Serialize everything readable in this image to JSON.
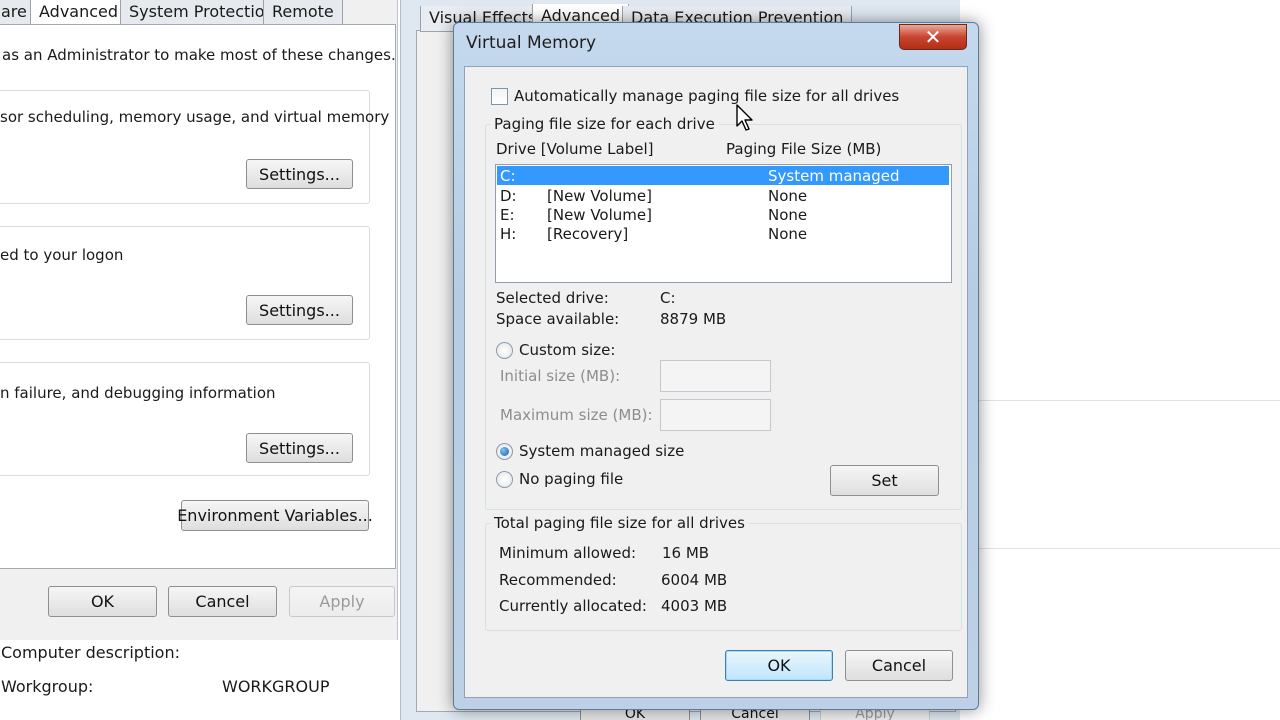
{
  "system_properties": {
    "tabs": [
      "are",
      "Advanced",
      "System Protection",
      "Remote"
    ],
    "admin_notice": "as an Administrator to make most of these changes.",
    "performance_desc": "sor scheduling, memory usage, and virtual memory",
    "profiles_desc": "ed to your logon",
    "startup_desc": "n failure, and debugging information",
    "settings_label": "Settings...",
    "env_vars_label": "Environment Variables...",
    "ok_label": "OK",
    "cancel_label": "Cancel",
    "apply_label": "Apply"
  },
  "computer_info": {
    "description_label": "Computer description:",
    "workgroup_label": "Workgroup:",
    "workgroup_value": "WORKGROUP"
  },
  "performance_options": {
    "tabs": [
      "Visual Effects",
      "Advanced",
      "Data Execution Prevention"
    ],
    "hidden_ok": "OK",
    "hidden_cancel": "Cancel",
    "hidden_apply": "Apply"
  },
  "virtual_memory": {
    "title": "Virtual Memory",
    "auto_manage_label": "Automatically manage paging file size for all drives",
    "auto_manage_checked": false,
    "each_drive_label": "Paging file size for each drive",
    "col_drive": "Drive  [Volume Label]",
    "col_size": "Paging File Size (MB)",
    "drives": [
      {
        "letter": "C:",
        "label": "",
        "size": "System managed",
        "selected": true
      },
      {
        "letter": "D:",
        "label": "[New Volume]",
        "size": "None",
        "selected": false
      },
      {
        "letter": "E:",
        "label": "[New Volume]",
        "size": "None",
        "selected": false
      },
      {
        "letter": "H:",
        "label": "[Recovery]",
        "size": "None",
        "selected": false
      }
    ],
    "selected_drive_label": "Selected drive:",
    "selected_drive_value": "C:",
    "space_available_label": "Space available:",
    "space_available_value": "8879 MB",
    "custom_size_label": "Custom size:",
    "initial_size_label": "Initial size (MB):",
    "maximum_size_label": "Maximum size (MB):",
    "initial_size_value": "",
    "maximum_size_value": "",
    "system_managed_label": "System managed size",
    "no_paging_label": "No paging file",
    "selected_option": "system_managed",
    "set_label": "Set",
    "total_label": "Total paging file size for all drives",
    "min_allowed_label": "Minimum allowed:",
    "min_allowed_value": "16 MB",
    "recommended_label": "Recommended:",
    "recommended_value": "6004 MB",
    "currently_allocated_label": "Currently allocated:",
    "currently_allocated_value": "4003 MB",
    "ok_label": "OK",
    "cancel_label": "Cancel",
    "close_glyph": "✕"
  },
  "colors": {
    "selection": "#3399ff",
    "close_button": "#c8452f",
    "window_frame": "#b7cce3",
    "dialog_face": "#f0f0f0"
  },
  "icons": {
    "close": "close-icon",
    "cursor": "mouse-pointer-icon"
  }
}
